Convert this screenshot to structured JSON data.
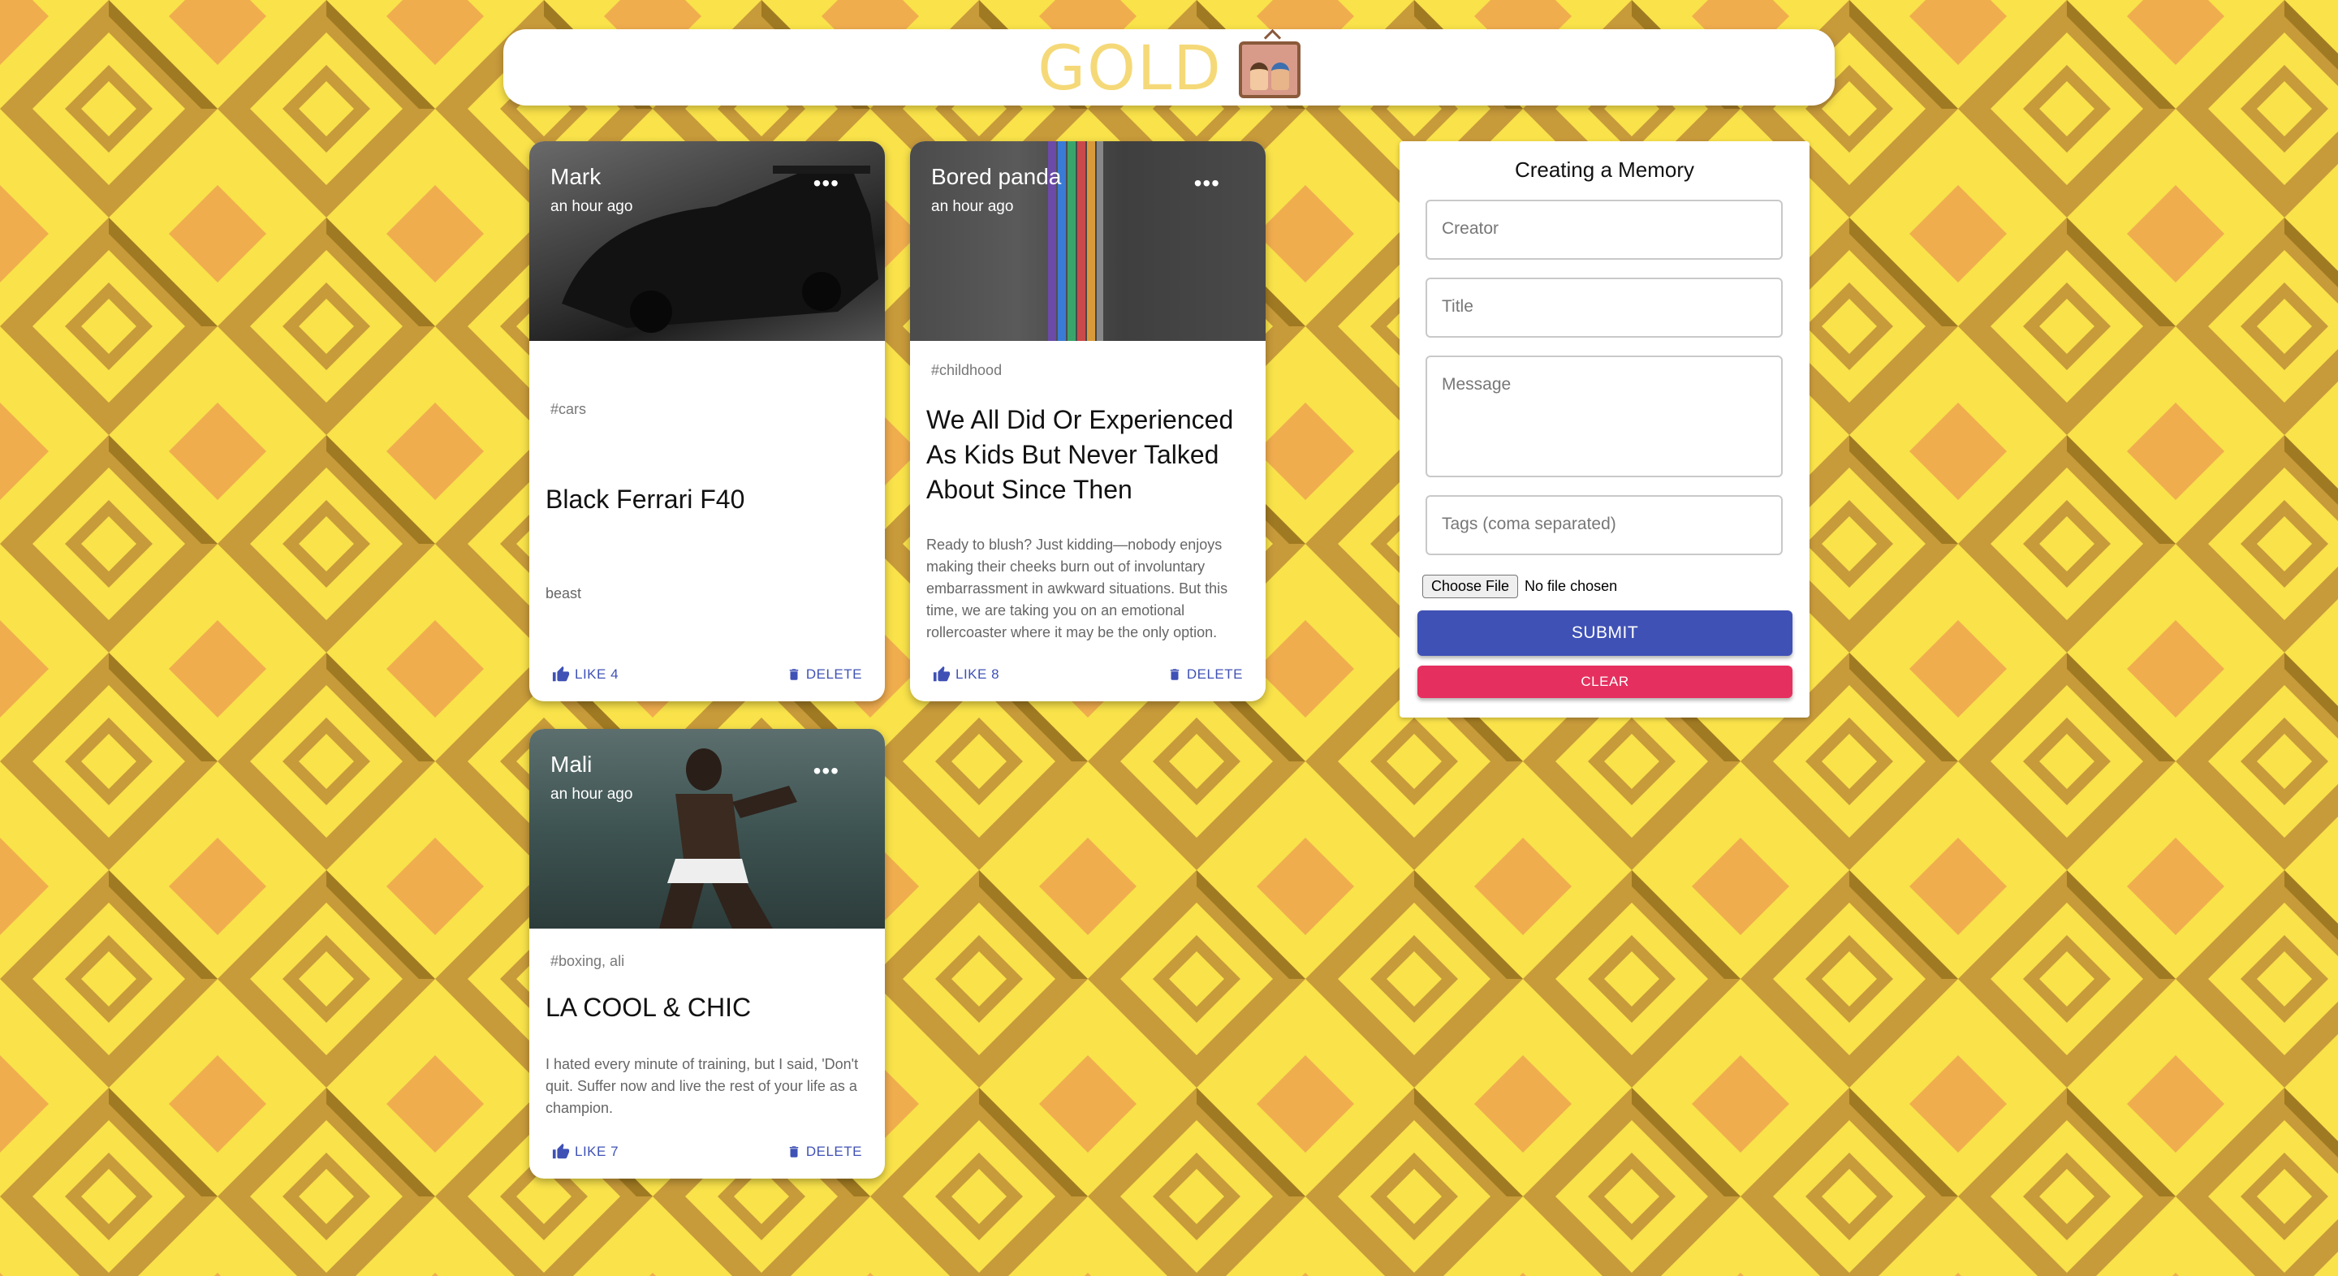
{
  "app": {
    "title": "GOLD"
  },
  "posts": [
    {
      "creator": "Mark",
      "time": "an hour ago",
      "tags": "#cars",
      "title": "Black Ferrari F40",
      "message": "beast",
      "like_label": "LIKE 4",
      "delete_label": "DELETE"
    },
    {
      "creator": "Bored panda",
      "time": "an hour ago",
      "tags": "#childhood",
      "title": "We All Did Or Experienced As Kids But Never Talked About Since Then",
      "message": "Ready to blush? Just kidding—nobody enjoys making their cheeks burn out of involuntary embarrassment in awkward situations. But this time, we are taking you on an emotional rollercoaster where it may be the only option.",
      "like_label": "LIKE 8",
      "delete_label": "DELETE"
    },
    {
      "creator": "Mali",
      "time": "an hour ago",
      "tags": "#boxing, ali",
      "title": "LA COOL & CHIC",
      "message": "I hated every minute of training, but I said, 'Don't quit. Suffer now and live the rest of your life as a champion.",
      "like_label": "LIKE 7",
      "delete_label": "DELETE"
    }
  ],
  "form": {
    "title": "Creating a Memory",
    "creator_placeholder": "Creator",
    "title_placeholder": "Title",
    "message_placeholder": "Message",
    "tags_placeholder": "Tags (coma separated)",
    "file_button": "Choose File",
    "file_status": "No file chosen",
    "submit_label": "SUBMIT",
    "clear_label": "CLEAR"
  },
  "colors": {
    "primary": "#3f51b5",
    "secondary": "#e5305f",
    "brand": "#f5d978",
    "background": "#f9e24a"
  },
  "icons": {
    "like": "thumb-up-icon",
    "delete": "trash-icon",
    "more": "more-horiz-icon"
  }
}
